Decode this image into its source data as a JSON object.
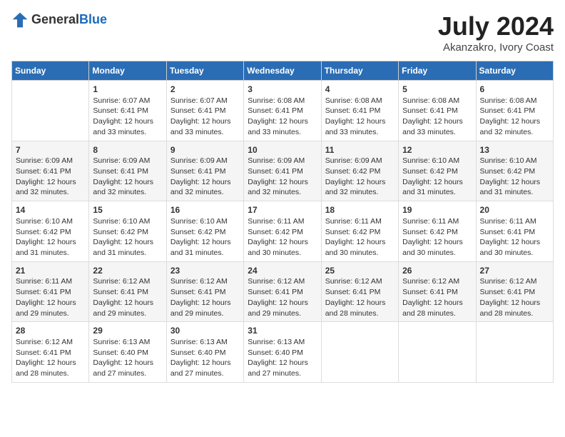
{
  "header": {
    "logo_general": "General",
    "logo_blue": "Blue",
    "title": "July 2024",
    "subtitle": "Akanzakro, Ivory Coast"
  },
  "days_of_week": [
    "Sunday",
    "Monday",
    "Tuesday",
    "Wednesday",
    "Thursday",
    "Friday",
    "Saturday"
  ],
  "weeks": [
    [
      {
        "day": "",
        "info": ""
      },
      {
        "day": "1",
        "info": "Sunrise: 6:07 AM\nSunset: 6:41 PM\nDaylight: 12 hours\nand 33 minutes."
      },
      {
        "day": "2",
        "info": "Sunrise: 6:07 AM\nSunset: 6:41 PM\nDaylight: 12 hours\nand 33 minutes."
      },
      {
        "day": "3",
        "info": "Sunrise: 6:08 AM\nSunset: 6:41 PM\nDaylight: 12 hours\nand 33 minutes."
      },
      {
        "day": "4",
        "info": "Sunrise: 6:08 AM\nSunset: 6:41 PM\nDaylight: 12 hours\nand 33 minutes."
      },
      {
        "day": "5",
        "info": "Sunrise: 6:08 AM\nSunset: 6:41 PM\nDaylight: 12 hours\nand 33 minutes."
      },
      {
        "day": "6",
        "info": "Sunrise: 6:08 AM\nSunset: 6:41 PM\nDaylight: 12 hours\nand 32 minutes."
      }
    ],
    [
      {
        "day": "7",
        "info": ""
      },
      {
        "day": "8",
        "info": "Sunrise: 6:09 AM\nSunset: 6:41 PM\nDaylight: 12 hours\nand 32 minutes."
      },
      {
        "day": "9",
        "info": "Sunrise: 6:09 AM\nSunset: 6:41 PM\nDaylight: 12 hours\nand 32 minutes."
      },
      {
        "day": "10",
        "info": "Sunrise: 6:09 AM\nSunset: 6:41 PM\nDaylight: 12 hours\nand 32 minutes."
      },
      {
        "day": "11",
        "info": "Sunrise: 6:09 AM\nSunset: 6:42 PM\nDaylight: 12 hours\nand 32 minutes."
      },
      {
        "day": "12",
        "info": "Sunrise: 6:10 AM\nSunset: 6:42 PM\nDaylight: 12 hours\nand 31 minutes."
      },
      {
        "day": "13",
        "info": "Sunrise: 6:10 AM\nSunset: 6:42 PM\nDaylight: 12 hours\nand 31 minutes."
      }
    ],
    [
      {
        "day": "14",
        "info": ""
      },
      {
        "day": "15",
        "info": "Sunrise: 6:10 AM\nSunset: 6:42 PM\nDaylight: 12 hours\nand 31 minutes."
      },
      {
        "day": "16",
        "info": "Sunrise: 6:10 AM\nSunset: 6:42 PM\nDaylight: 12 hours\nand 31 minutes."
      },
      {
        "day": "17",
        "info": "Sunrise: 6:11 AM\nSunset: 6:42 PM\nDaylight: 12 hours\nand 30 minutes."
      },
      {
        "day": "18",
        "info": "Sunrise: 6:11 AM\nSunset: 6:42 PM\nDaylight: 12 hours\nand 30 minutes."
      },
      {
        "day": "19",
        "info": "Sunrise: 6:11 AM\nSunset: 6:42 PM\nDaylight: 12 hours\nand 30 minutes."
      },
      {
        "day": "20",
        "info": "Sunrise: 6:11 AM\nSunset: 6:41 PM\nDaylight: 12 hours\nand 30 minutes."
      }
    ],
    [
      {
        "day": "21",
        "info": ""
      },
      {
        "day": "22",
        "info": "Sunrise: 6:12 AM\nSunset: 6:41 PM\nDaylight: 12 hours\nand 29 minutes."
      },
      {
        "day": "23",
        "info": "Sunrise: 6:12 AM\nSunset: 6:41 PM\nDaylight: 12 hours\nand 29 minutes."
      },
      {
        "day": "24",
        "info": "Sunrise: 6:12 AM\nSunset: 6:41 PM\nDaylight: 12 hours\nand 29 minutes."
      },
      {
        "day": "25",
        "info": "Sunrise: 6:12 AM\nSunset: 6:41 PM\nDaylight: 12 hours\nand 28 minutes."
      },
      {
        "day": "26",
        "info": "Sunrise: 6:12 AM\nSunset: 6:41 PM\nDaylight: 12 hours\nand 28 minutes."
      },
      {
        "day": "27",
        "info": "Sunrise: 6:12 AM\nSunset: 6:41 PM\nDaylight: 12 hours\nand 28 minutes."
      }
    ],
    [
      {
        "day": "28",
        "info": "Sunrise: 6:12 AM\nSunset: 6:41 PM\nDaylight: 12 hours\nand 28 minutes."
      },
      {
        "day": "29",
        "info": "Sunrise: 6:13 AM\nSunset: 6:40 PM\nDaylight: 12 hours\nand 27 minutes."
      },
      {
        "day": "30",
        "info": "Sunrise: 6:13 AM\nSunset: 6:40 PM\nDaylight: 12 hours\nand 27 minutes."
      },
      {
        "day": "31",
        "info": "Sunrise: 6:13 AM\nSunset: 6:40 PM\nDaylight: 12 hours\nand 27 minutes."
      },
      {
        "day": "",
        "info": ""
      },
      {
        "day": "",
        "info": ""
      },
      {
        "day": "",
        "info": ""
      }
    ]
  ],
  "week_7_sunday": "Sunrise: 6:09 AM\nSunset: 6:41 PM\nDaylight: 12 hours\nand 32 minutes.",
  "week_14_sunday": "Sunrise: 6:10 AM\nSunset: 6:42 PM\nDaylight: 12 hours\nand 31 minutes.",
  "week_21_sunday": "Sunrise: 6:11 AM\nSunset: 6:41 PM\nDaylight: 12 hours\nand 29 minutes."
}
